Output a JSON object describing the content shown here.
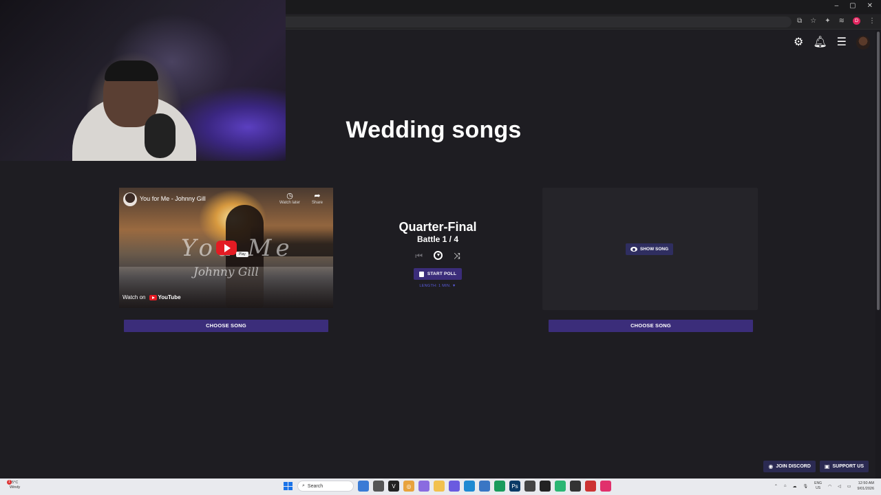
{
  "browser": {
    "window_controls": [
      "–",
      "▢",
      "✕"
    ],
    "profile_initial": "D"
  },
  "header": {
    "icons": [
      "gear-icon",
      "bell-icon",
      "menu-icon",
      "avatar"
    ]
  },
  "page": {
    "title": "Wedding songs"
  },
  "left_song": {
    "video_title": "You for Me - Johnny Gill",
    "overlay_title": "You  Me",
    "overlay_artist": "Johnny Gill",
    "watch_later_label": "Watch later",
    "share_label": "Share",
    "play_tooltip": "Play",
    "watch_on_label": "Watch on",
    "youtube_label": "YouTube",
    "choose_label": "CHOOSE SONG"
  },
  "battle": {
    "stage": "Quarter-Final",
    "battle_label": "Battle 1 / 4",
    "start_poll_label": "START POLL",
    "length_label": "LENGTH: 1 MIN. ▼"
  },
  "right_song": {
    "show_label": "SHOW SONG",
    "choose_label": "CHOOSE SONG"
  },
  "footer": {
    "discord_label": "JOIN DISCORD",
    "support_label": "SUPPORT US"
  },
  "taskbar": {
    "weather_temp": "25°C",
    "weather_desc": "Windy",
    "weather_badge": "1",
    "search_placeholder": "Search",
    "lang_top": "ENG",
    "lang_bottom": "US",
    "time": "12:50 AM",
    "date": "9/01/2026"
  },
  "colors": {
    "background": "#1e1d22",
    "button_purple": "#3b2d7a",
    "accent_blue": "#5b5de0",
    "youtube_red": "#e31b23"
  }
}
